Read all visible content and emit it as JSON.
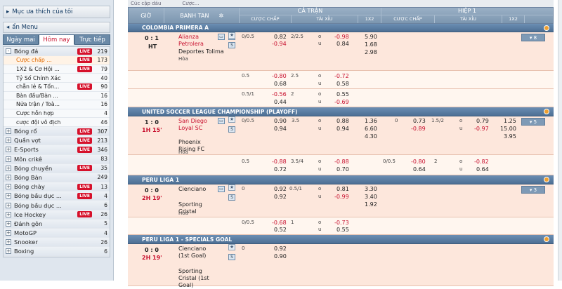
{
  "sidebar": {
    "favorites": "Mục ưa thích của tôi",
    "menu": "ẩn Menu",
    "tabs": [
      "Ngày mai",
      "Hôm nay",
      "Trực tiếp"
    ],
    "items": [
      {
        "label": "Bóng đá",
        "count": "219",
        "live": true,
        "type": "main"
      },
      {
        "label": "Cược chấp ...",
        "count": "173",
        "live": true,
        "type": "sub",
        "selected": true
      },
      {
        "label": "1X2 & Cơ Hội ...",
        "count": "79",
        "live": true,
        "type": "sub"
      },
      {
        "label": "Tỷ Số Chính Xác",
        "count": "40",
        "live": false,
        "type": "sub"
      },
      {
        "label": "chẵn lẻ & Tổn...",
        "count": "90",
        "live": true,
        "type": "sub"
      },
      {
        "label": "Bàn đầu/Bàn ...",
        "count": "16",
        "live": false,
        "type": "sub"
      },
      {
        "label": "Nửa trận / Toà...",
        "count": "16",
        "live": false,
        "type": "sub"
      },
      {
        "label": "Cược hỗn hợp",
        "count": "4",
        "live": false,
        "type": "sub"
      },
      {
        "label": "cược đội vô địch",
        "count": "46",
        "live": false,
        "type": "sub"
      },
      {
        "label": "Bóng rổ",
        "count": "307",
        "live": true,
        "type": "main"
      },
      {
        "label": "Quần vợt",
        "count": "213",
        "live": true,
        "type": "main"
      },
      {
        "label": "E-Sports",
        "count": "346",
        "live": true,
        "type": "main"
      },
      {
        "label": "Môn crikê",
        "count": "83",
        "live": false,
        "type": "main"
      },
      {
        "label": "Bóng chuyền",
        "count": "35",
        "live": true,
        "type": "main"
      },
      {
        "label": "Bóng Bàn",
        "count": "249",
        "live": false,
        "type": "main"
      },
      {
        "label": "Bóng chày",
        "count": "13",
        "live": true,
        "type": "main"
      },
      {
        "label": "Bóng bầu dục ...",
        "count": "4",
        "live": true,
        "type": "main"
      },
      {
        "label": "Bóng bầu dục ...",
        "count": "6",
        "live": false,
        "type": "main"
      },
      {
        "label": "Ice Hockey",
        "count": "26",
        "live": true,
        "type": "main"
      },
      {
        "label": "Đánh gôn",
        "count": "5",
        "live": false,
        "type": "main"
      },
      {
        "label": "MotoGP",
        "count": "4",
        "live": false,
        "type": "main"
      },
      {
        "label": "Snooker",
        "count": "26",
        "live": false,
        "type": "main"
      },
      {
        "label": "Boxing",
        "count": "6",
        "live": false,
        "type": "main"
      }
    ]
  },
  "topbar": [
    "Cúc cập dáu",
    "Cược..."
  ],
  "header": {
    "time": "GIỜ",
    "teams": "BANH TAN",
    "full": "CẢ TRẬN",
    "half": "HIỆP 1",
    "handicap": "CƯỢC CHẤP",
    "ou": "TÀI XỈU",
    "x12": "1X2"
  },
  "leagues": [
    "COLOMBIA PRIMERA A",
    "UNITED SOCCER LEAGUE CHAMPIONSHIP (PLAYOFF)",
    "PERU LIGA 1",
    "PERU LIGA 1 - SPECIALS GOAL"
  ],
  "m1": {
    "score": "0 : 1",
    "time": "HT",
    "home": "Alianza Petrolera",
    "away": "Deportes Tolima",
    "draw": "Hòa",
    "hc": "0/0.5",
    "h1": "0.82",
    "h2": "-0.94",
    "ouL": "2/2.5",
    "o": "o",
    "u": "u",
    "ou1": "-0.98",
    "ou2": "0.84",
    "x1": "5.90",
    "x2": "1.68",
    "x3": "2.98",
    "more": "▾ 8"
  },
  "m1b": {
    "hc": "0.5",
    "h1": "-0.80",
    "h2": "0.68",
    "ouL": "2.5",
    "ou1": "-0.72",
    "ou2": "0.58"
  },
  "m1c": {
    "hc": "0.5/1",
    "h1": "-0.56",
    "h2": "0.44",
    "ouL": "2",
    "ou1": "0.55",
    "ou2": "-0.69"
  },
  "m2": {
    "score": "1 : 0",
    "time": "1H 15'",
    "home": "San Diego Loyal SC",
    "away": "Phoenix Rising FC",
    "draw": "Hòa",
    "hc": "0/0.5",
    "h1": "0.90",
    "h2": "0.94",
    "ouL": "3.5",
    "ou1": "0.88",
    "ou2": "0.94",
    "x1": "1.36",
    "x2": "6.60",
    "x3": "4.30",
    "hhc": "0",
    "hh1": "0.73",
    "hh2": "-0.89",
    "houL": "1.5/2",
    "hou1": "0.79",
    "hou2": "-0.97",
    "hx1": "1.25",
    "hx2": "15.00",
    "hx3": "3.95",
    "more": "▾ 5"
  },
  "m2b": {
    "hc": "0.5",
    "h1": "-0.88",
    "h2": "0.72",
    "ouL": "3.5/4",
    "ou1": "-0.88",
    "ou2": "0.70",
    "hhc": "0/0.5",
    "hh1": "-0.80",
    "hh2": "0.64",
    "houL": "2",
    "hou1": "-0.82",
    "hou2": "0.64"
  },
  "m3": {
    "score": "0 : 0",
    "time": "2H 19'",
    "home": "Cienciano",
    "away": "Sporting Cristal",
    "draw": "Hòa",
    "hc": "0",
    "h1": "0.92",
    "h2": "0.92",
    "ouL": "0.5/1",
    "ou1": "0.81",
    "ou2": "-0.99",
    "x1": "3.30",
    "x2": "3.40",
    "x3": "1.92",
    "more": "▾ 3"
  },
  "m3b": {
    "hc": "0/0.5",
    "h1": "-0.68",
    "h2": "0.52",
    "ouL": "1",
    "ou1": "-0.73",
    "ou2": "0.55"
  },
  "m4": {
    "score": "0 : 0",
    "time": "2H 19'",
    "home": "Cienciano (1st Goal)",
    "away": "Sporting Cristal (1st Goal)",
    "hc": "0",
    "h1": "0.92",
    "h2": "0.90"
  }
}
